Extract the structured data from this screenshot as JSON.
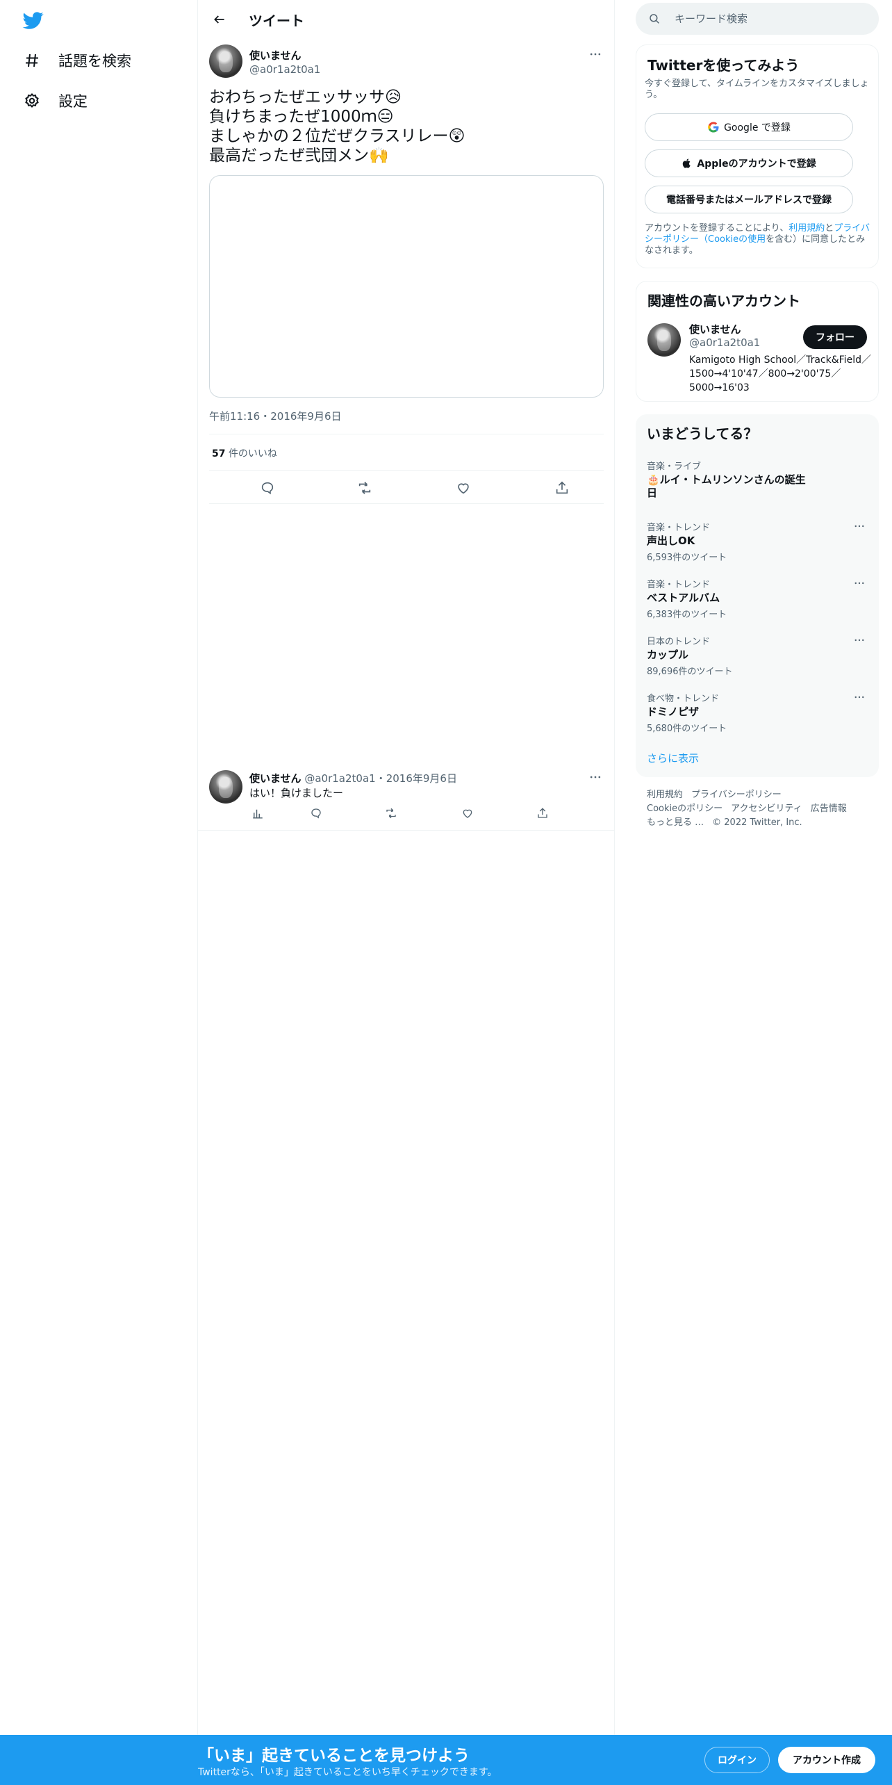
{
  "nav": {
    "logo_icon": "twitter-bird-icon",
    "items": [
      {
        "icon": "hashtag-icon",
        "label": "話題を検索"
      },
      {
        "icon": "gear-icon",
        "label": "設定"
      }
    ]
  },
  "header": {
    "back_icon": "back-arrow-icon",
    "title": "ツイート"
  },
  "tweet": {
    "author_name": "使いません",
    "author_handle": "@a0r1a2t0a1",
    "lines": [
      "おわちったぜエッサッサ😥",
      "負けちまったぜ1000ｍ😑",
      "ましゃかの２位だぜクラスリレー😲",
      "最高だったぜ弐団メン🙌"
    ],
    "timestamp": "午前11:16・2016年9月6日",
    "likes_count": "57",
    "likes_label": "件のいいね"
  },
  "reply": {
    "author_name": "使いません",
    "author_handle": "@a0r1a2t0a1",
    "separator": "・",
    "date": "2016年9月6日",
    "text": "はい！負けましたー"
  },
  "search": {
    "placeholder": "キーワード検索"
  },
  "signup": {
    "title": "Twitterを使ってみよう",
    "subtitle": "今すぐ登録して、タイムラインをカスタマイズしましょう。",
    "google_label": "Google で登録",
    "apple_label": "Appleのアカウントで登録",
    "phone_label": "電話番号またはメールアドレスで登録",
    "legal_prefix": "アカウントを登録することにより、",
    "legal_terms": "利用規約",
    "legal_and": "と",
    "legal_privacy": "プライバシーポリシー（Cookieの使用",
    "legal_suffix": "を含む）に同意したとみなされます。"
  },
  "related": {
    "title": "関連性の高いアカウント",
    "name": "使いません",
    "handle": "@a0r1a2t0a1",
    "follow_label": "フォロー",
    "bio": "Kamigoto High School／Track&Field／1500→4'10'47／800→2'00'75／5000→16'03"
  },
  "trends": {
    "title": "いまどうしてる？",
    "items": [
      {
        "category": "音楽・ライブ",
        "name": "🎂ルイ・トムリンソンさんの誕生日",
        "count": ""
      },
      {
        "category": "音楽・トレンド",
        "name": "声出しOK",
        "count": "6,593件のツイート"
      },
      {
        "category": "音楽・トレンド",
        "name": "ベストアルバム",
        "count": "6,383件のツイート"
      },
      {
        "category": "日本のトレンド",
        "name": "カップル",
        "count": "89,696件のツイート"
      },
      {
        "category": "食べ物・トレンド",
        "name": "ドミノピザ",
        "count": "5,680件のツイート"
      }
    ],
    "show_more": "さらに表示"
  },
  "footer": {
    "links": [
      "利用規約",
      "プライバシーポリシー",
      "Cookieのポリシー",
      "アクセシビリティ",
      "広告情報",
      "もっと見る …"
    ],
    "copyright": "© 2022 Twitter, Inc."
  },
  "bottom_bar": {
    "title": "「いま」起きていることを見つけよう",
    "subtitle": "Twitterなら、「いま」起きていることをいち早くチェックできます。",
    "login_label": "ログイン",
    "signup_label": "アカウント作成"
  },
  "colors": {
    "accent": "#1d9bf0",
    "text": "#0f1419",
    "secondary": "#536471",
    "border": "#eff3f4"
  }
}
